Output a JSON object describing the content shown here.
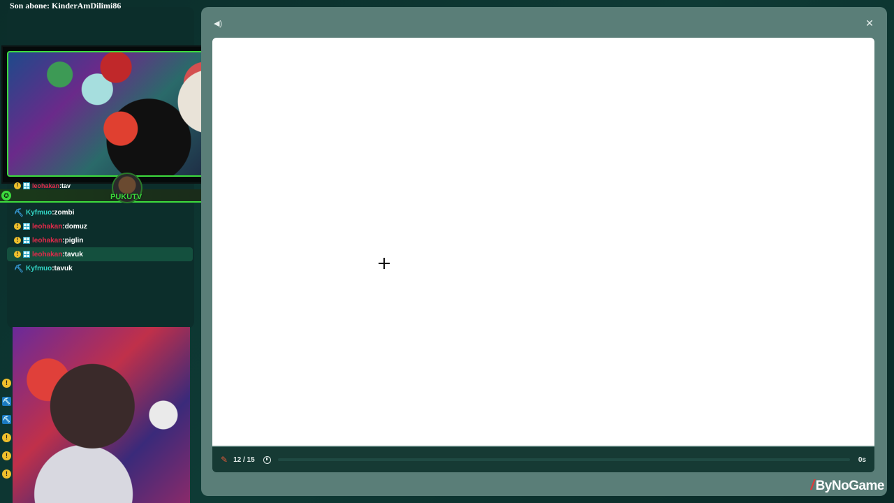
{
  "stream_overlay": {
    "banner_text": "Son abone: KinderAmDilimi86",
    "brand": "PUKUTV",
    "partial_line": {
      "user": "leohakan",
      "message": "tav"
    }
  },
  "chat": {
    "messages": [
      {
        "badges": [
          "pickaxe"
        ],
        "user": "Kyfmuo",
        "user_color": "#33d4c4",
        "message": "zombi",
        "highlighted": false
      },
      {
        "badges": [
          "sub",
          "grid"
        ],
        "user": "leohakan",
        "user_color": "#e02a4a",
        "message": "domuz",
        "highlighted": false
      },
      {
        "badges": [
          "sub",
          "grid"
        ],
        "user": "leohakan",
        "user_color": "#e02a4a",
        "message": "piglin",
        "highlighted": false
      },
      {
        "badges": [
          "sub",
          "grid"
        ],
        "user": "leohakan",
        "user_color": "#e02a4a",
        "message": "tavuk",
        "highlighted": true
      },
      {
        "badges": [
          "pickaxe"
        ],
        "user": "Kyfmuo",
        "user_color": "#33d4c4",
        "message": "tavuk",
        "highlighted": false
      }
    ],
    "message_separator": ":"
  },
  "side_badges": [
    "sub",
    "pickaxe",
    "pickaxe",
    "sub",
    "sub",
    "sub"
  ],
  "game": {
    "sound_icon": "speaker-icon",
    "close_icon": "close-icon",
    "round": "12 / 15",
    "time": "0s",
    "time_progress": 0.0
  },
  "brand_logo": {
    "mark": "/",
    "text": "ByNoGame"
  },
  "colors": {
    "panel": "#5a7e78",
    "status_bar": "#163a34",
    "accent_green": "#3ddc3d",
    "chat_highlight": "#14503e"
  }
}
